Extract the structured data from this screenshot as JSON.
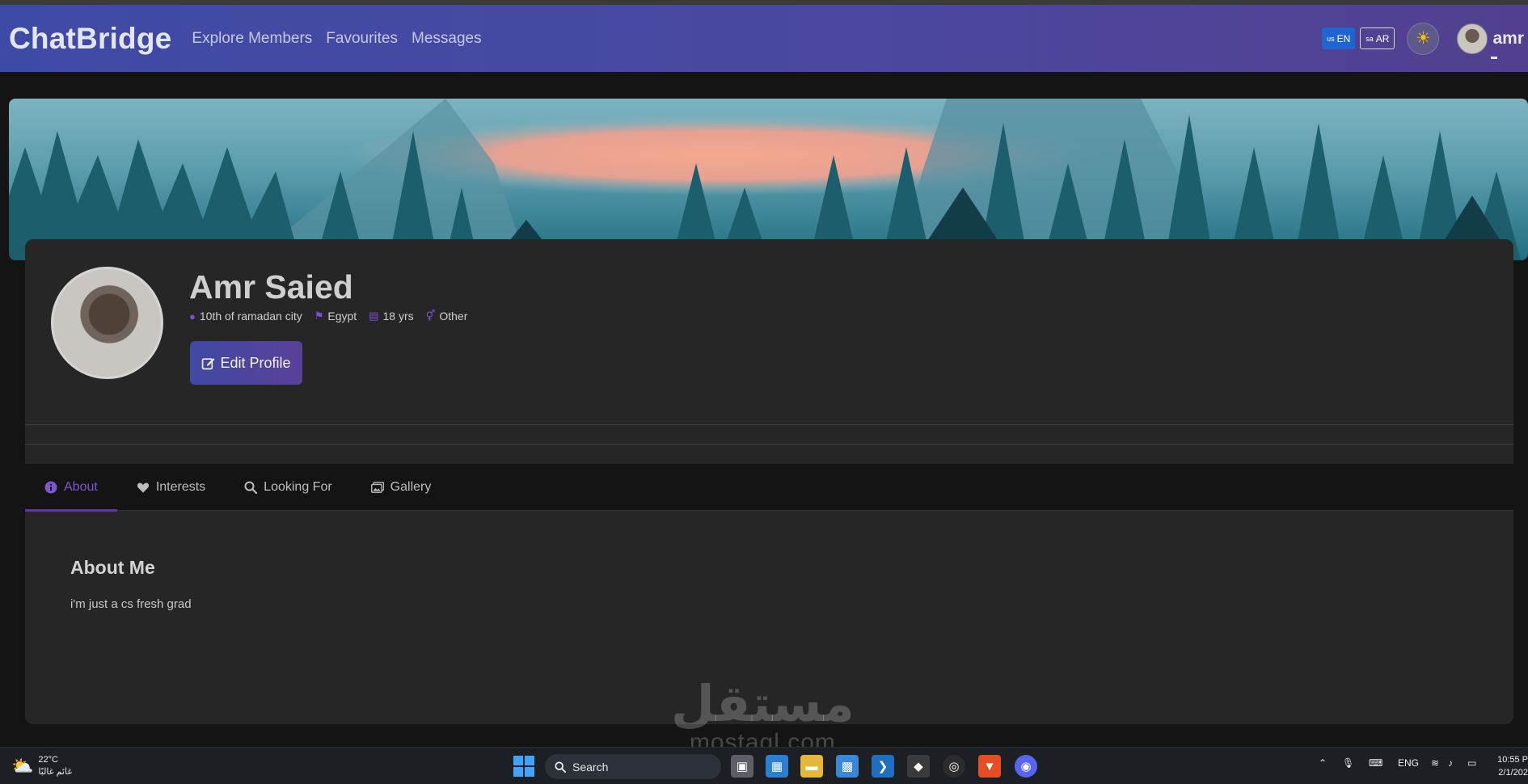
{
  "nav": {
    "brand": "ChatBridge",
    "links": [
      "Explore Members",
      "Favourites",
      "Messages"
    ],
    "lang_en_flag": "us",
    "lang_en": "EN",
    "lang_ar_flag": "sa",
    "lang_ar": "AR",
    "theme_icon": "sun-icon",
    "username": "amr"
  },
  "profile": {
    "name": "Amr Saied",
    "location": "10th of ramadan city",
    "country": "Egypt",
    "age": "18 yrs",
    "gender": "Other",
    "edit_label": "Edit Profile"
  },
  "tabs": [
    {
      "label": "About",
      "icon": "info-circle-icon",
      "active": true
    },
    {
      "label": "Interests",
      "icon": "heart-icon",
      "active": false
    },
    {
      "label": "Looking For",
      "icon": "search-icon",
      "active": false
    },
    {
      "label": "Gallery",
      "icon": "images-icon",
      "active": false
    }
  ],
  "about": {
    "title": "About Me",
    "text": "i'm just a cs fresh grad"
  },
  "watermark": {
    "arabic": "مستقل",
    "latin": "mostaql.com"
  },
  "taskbar": {
    "temperature": "22°C",
    "weather_desc": "غائم غالبًا",
    "search_label": "Search",
    "language": "ENG",
    "time": "10:55 P",
    "date": "2/1/202"
  },
  "colors": {
    "accent": "#7b57d0",
    "nav_start": "#3e4ba6",
    "nav_end": "#533f8f"
  }
}
